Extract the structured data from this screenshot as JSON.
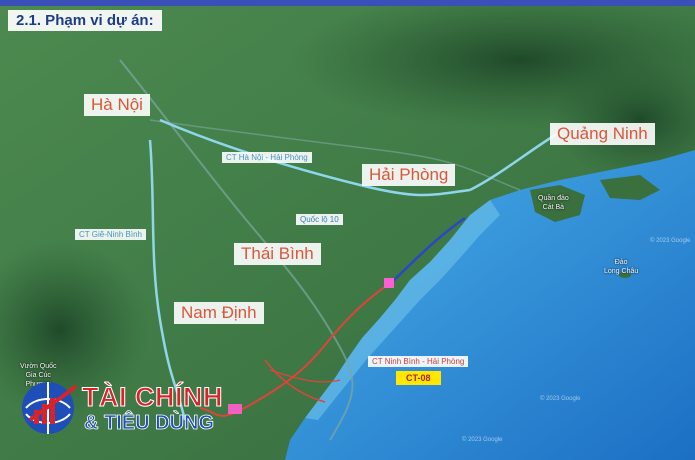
{
  "header": {
    "section_title": "2.1. Phạm vi dự án:"
  },
  "cities": {
    "ha_noi": "Hà Nội",
    "hai_phong": "Hải Phòng",
    "quang_ninh": "Quảng Ninh",
    "thai_binh": "Thái Bình",
    "nam_dinh": "Nam Định"
  },
  "routes": {
    "hn_hp": "CT Hà Nội - Hải Phòng",
    "gie_nb": "CT Giẽ-Ninh Bình",
    "ql10": "Quốc lộ 10",
    "nb_hp": "CT Ninh Bình - Hải Phòng"
  },
  "project_code": "CT-08",
  "places": {
    "quan_dao_cat_ba": "Quần đảo\nCát Bà",
    "dao_long_chau": "Đảo\nLong Châu",
    "vuon_quoc_gia": "Vườn Quốc\nGia Cúc\nPhương"
  },
  "attribution": [
    "© 2023 Google",
    "© 2023 Google",
    "© 2023 Google"
  ],
  "watermark": {
    "line1": "TÀI CHÍNH",
    "line2": "& TIÊU DÙNG"
  },
  "colors": {
    "sea": "#2a8bd8",
    "land": "#3f7a46",
    "route_existing": "#8fd6ea",
    "route_project_blue": "#2c46c8",
    "route_project_red": "#e0433a",
    "city_label": "#d9573c",
    "title": "#1d3c8c",
    "ct_tag": "#ffe700"
  }
}
